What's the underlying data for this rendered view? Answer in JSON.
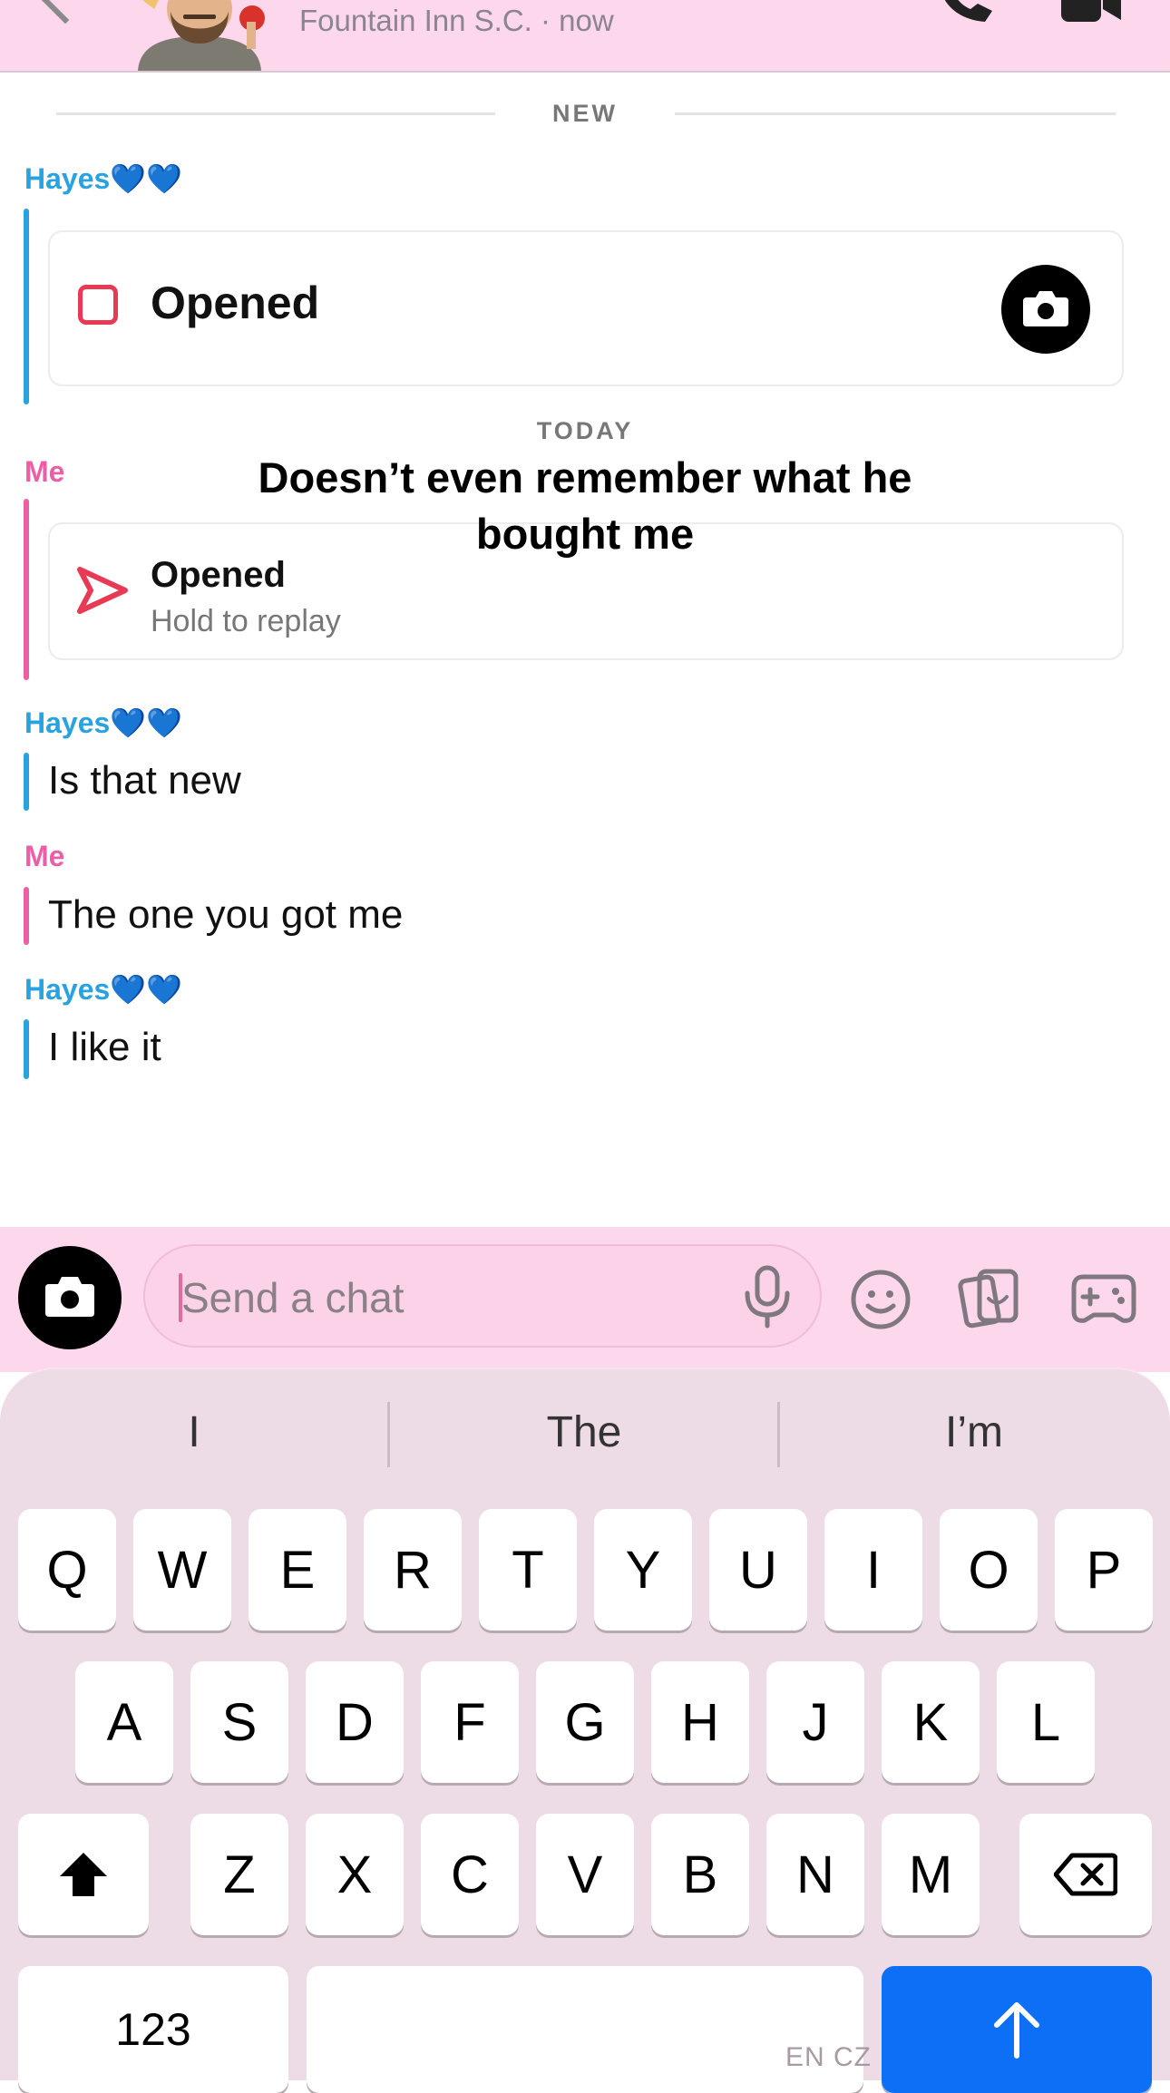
{
  "header": {
    "subtitle": "Fountain Inn S.C. · now"
  },
  "chat": {
    "dividers": {
      "new": "NEW",
      "today": "TODAY"
    },
    "messages": [
      {
        "sender": "Hayes💙💙",
        "type": "snap",
        "status": "Opened"
      },
      {
        "sender": "Me",
        "type": "snap",
        "status": "Opened",
        "detail": "Hold to replay"
      },
      {
        "sender": "Hayes💙💙",
        "type": "text",
        "text": "Is that new"
      },
      {
        "sender": "Me",
        "type": "text",
        "text": "The one you got me"
      },
      {
        "sender": "Hayes💙💙",
        "type": "text",
        "text": "I like it"
      }
    ],
    "overlay_caption": "Doesn’t even remember what he bought me"
  },
  "input": {
    "placeholder": "Send a chat"
  },
  "keyboard": {
    "suggestions": [
      "I",
      "The",
      "I’m"
    ],
    "row1": [
      "Q",
      "W",
      "E",
      "R",
      "T",
      "Y",
      "U",
      "I",
      "O",
      "P"
    ],
    "row2": [
      "A",
      "S",
      "D",
      "F",
      "G",
      "H",
      "J",
      "K",
      "L"
    ],
    "row3": [
      "Z",
      "X",
      "C",
      "V",
      "B",
      "N",
      "M"
    ],
    "numbers_key": "123",
    "language_label": "EN CZ"
  },
  "colors": {
    "header_bg": "#fdd7ec",
    "friend": "#29a2e0",
    "me": "#ec5fa7",
    "snap_red": "#e83a55",
    "send_blue": "#0d6ff6"
  }
}
